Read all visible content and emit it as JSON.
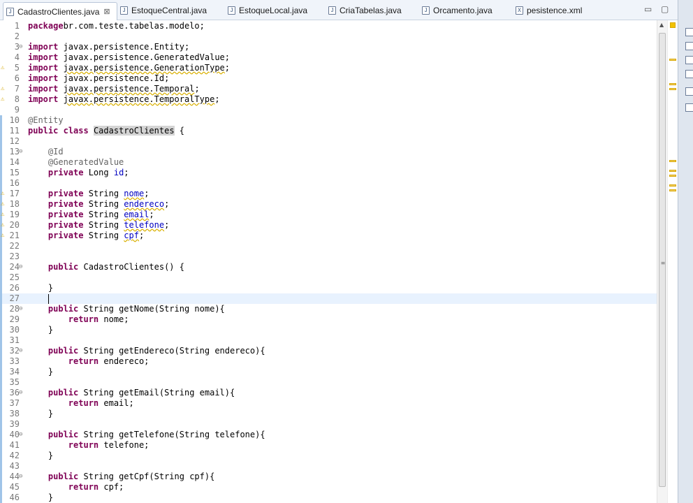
{
  "tabs": [
    {
      "label": "CadastroClientes.java",
      "icon": "java-file-icon",
      "glyph": "J",
      "active": true
    },
    {
      "label": "EstoqueCentral.java",
      "icon": "java-file-icon",
      "glyph": "J"
    },
    {
      "label": "EstoqueLocal.java",
      "icon": "java-file-icon",
      "glyph": "J"
    },
    {
      "label": "CriaTabelas.java",
      "icon": "java-file-icon",
      "glyph": "J"
    },
    {
      "label": "Orcamento.java",
      "icon": "java-file-icon",
      "glyph": "J"
    },
    {
      "label": "pesistence.xml",
      "icon": "xml-file-icon",
      "glyph": "X"
    }
  ],
  "close_glyph": "⊠",
  "window_controls": {
    "minimize": "▭",
    "maximize": "▢"
  },
  "colors": {
    "keyword": "#7f0055",
    "annotation": "#646464",
    "field": "#0000c0",
    "current_line": "#e8f2fe",
    "warning": "#d9b000"
  },
  "editor": {
    "current_line": 27,
    "lines": [
      {
        "n": 1,
        "parts": [
          [
            "kw",
            "package"
          ],
          [
            "",
            "br.com.teste.tabelas.modelo;"
          ]
        ]
      },
      {
        "n": 2,
        "parts": []
      },
      {
        "n": 3,
        "fold": true,
        "parts": [
          [
            "kw",
            "import"
          ],
          [
            "",
            " javax.persistence.Entity;"
          ]
        ]
      },
      {
        "n": 4,
        "parts": [
          [
            "kw",
            "import"
          ],
          [
            "",
            " javax.persistence.GeneratedValue;"
          ]
        ]
      },
      {
        "n": 5,
        "warn": true,
        "parts": [
          [
            "kw",
            "import"
          ],
          [
            "",
            " "
          ],
          [
            "sq",
            "javax.persistence.GenerationType"
          ],
          [
            "",
            ";"
          ]
        ]
      },
      {
        "n": 6,
        "parts": [
          [
            "kw",
            "import"
          ],
          [
            "",
            " javax.persistence.Id;"
          ]
        ]
      },
      {
        "n": 7,
        "warn": true,
        "parts": [
          [
            "kw",
            "import"
          ],
          [
            "",
            " "
          ],
          [
            "sq",
            "javax.persistence.Temporal"
          ],
          [
            "",
            ";"
          ]
        ]
      },
      {
        "n": 8,
        "warn": true,
        "parts": [
          [
            "kw",
            "import"
          ],
          [
            "",
            " "
          ],
          [
            "sq",
            "javax.persistence.TemporalType"
          ],
          [
            "",
            ";"
          ]
        ]
      },
      {
        "n": 9,
        "parts": []
      },
      {
        "n": 10,
        "bar": true,
        "parts": [
          [
            "ann",
            "@Entity"
          ]
        ]
      },
      {
        "n": 11,
        "bar": true,
        "parts": [
          [
            "kw",
            "public"
          ],
          [
            "",
            " "
          ],
          [
            "kw",
            "class"
          ],
          [
            "",
            " "
          ],
          [
            "hl",
            "CadastroClientes"
          ],
          [
            "",
            " {"
          ]
        ]
      },
      {
        "n": 12,
        "bar": true,
        "parts": []
      },
      {
        "n": 13,
        "bar": true,
        "fold": true,
        "parts": [
          [
            "",
            "    "
          ],
          [
            "ann",
            "@Id"
          ]
        ]
      },
      {
        "n": 14,
        "bar": true,
        "parts": [
          [
            "",
            "    "
          ],
          [
            "ann",
            "@GeneratedValue"
          ]
        ]
      },
      {
        "n": 15,
        "bar": true,
        "parts": [
          [
            "",
            "    "
          ],
          [
            "kw",
            "private"
          ],
          [
            "",
            " Long "
          ],
          [
            "fld",
            "id"
          ],
          [
            "",
            ";"
          ]
        ]
      },
      {
        "n": 16,
        "bar": true,
        "parts": []
      },
      {
        "n": 17,
        "bar": true,
        "warn": true,
        "parts": [
          [
            "",
            "    "
          ],
          [
            "kw",
            "private"
          ],
          [
            "",
            " String "
          ],
          [
            "fld sq",
            "nome"
          ],
          [
            "",
            ";"
          ]
        ]
      },
      {
        "n": 18,
        "bar": true,
        "warn": true,
        "parts": [
          [
            "",
            "    "
          ],
          [
            "kw",
            "private"
          ],
          [
            "",
            " String "
          ],
          [
            "fld sq",
            "endereco"
          ],
          [
            "",
            ";"
          ]
        ]
      },
      {
        "n": 19,
        "bar": true,
        "warn": true,
        "parts": [
          [
            "",
            "    "
          ],
          [
            "kw",
            "private"
          ],
          [
            "",
            " String "
          ],
          [
            "fld sq",
            "email"
          ],
          [
            "",
            ";"
          ]
        ]
      },
      {
        "n": 20,
        "bar": true,
        "warn": true,
        "parts": [
          [
            "",
            "    "
          ],
          [
            "kw",
            "private"
          ],
          [
            "",
            " String "
          ],
          [
            "fld sq",
            "telefone"
          ],
          [
            "",
            ";"
          ]
        ]
      },
      {
        "n": 21,
        "bar": true,
        "warn": true,
        "parts": [
          [
            "",
            "    "
          ],
          [
            "kw",
            "private"
          ],
          [
            "",
            " String "
          ],
          [
            "fld sq",
            "cpf"
          ],
          [
            "",
            ";"
          ]
        ]
      },
      {
        "n": 22,
        "bar": true,
        "parts": []
      },
      {
        "n": 23,
        "bar": true,
        "parts": []
      },
      {
        "n": 24,
        "bar": true,
        "fold": true,
        "parts": [
          [
            "",
            "    "
          ],
          [
            "kw",
            "public"
          ],
          [
            "",
            " CadastroClientes() {"
          ]
        ]
      },
      {
        "n": 25,
        "bar": true,
        "parts": []
      },
      {
        "n": 26,
        "bar": true,
        "parts": [
          [
            "",
            "    }"
          ]
        ]
      },
      {
        "n": 27,
        "bar": true,
        "caret": true,
        "parts": [
          [
            "",
            "    "
          ]
        ]
      },
      {
        "n": 28,
        "bar": true,
        "fold": true,
        "parts": [
          [
            "",
            "    "
          ],
          [
            "kw",
            "public"
          ],
          [
            "",
            " String getNome(String nome){"
          ]
        ]
      },
      {
        "n": 29,
        "bar": true,
        "parts": [
          [
            "",
            "        "
          ],
          [
            "kw",
            "return"
          ],
          [
            "",
            " nome;"
          ]
        ]
      },
      {
        "n": 30,
        "bar": true,
        "parts": [
          [
            "",
            "    }"
          ]
        ]
      },
      {
        "n": 31,
        "bar": true,
        "parts": []
      },
      {
        "n": 32,
        "bar": true,
        "fold": true,
        "parts": [
          [
            "",
            "    "
          ],
          [
            "kw",
            "public"
          ],
          [
            "",
            " String getEndereco(String endereco){"
          ]
        ]
      },
      {
        "n": 33,
        "bar": true,
        "parts": [
          [
            "",
            "        "
          ],
          [
            "kw",
            "return"
          ],
          [
            "",
            " endereco;"
          ]
        ]
      },
      {
        "n": 34,
        "bar": true,
        "parts": [
          [
            "",
            "    }"
          ]
        ]
      },
      {
        "n": 35,
        "bar": true,
        "parts": []
      },
      {
        "n": 36,
        "bar": true,
        "fold": true,
        "parts": [
          [
            "",
            "    "
          ],
          [
            "kw",
            "public"
          ],
          [
            "",
            " String getEmail(String email){"
          ]
        ]
      },
      {
        "n": 37,
        "bar": true,
        "parts": [
          [
            "",
            "        "
          ],
          [
            "kw",
            "return"
          ],
          [
            "",
            " email;"
          ]
        ]
      },
      {
        "n": 38,
        "bar": true,
        "parts": [
          [
            "",
            "    }"
          ]
        ]
      },
      {
        "n": 39,
        "bar": true,
        "parts": []
      },
      {
        "n": 40,
        "bar": true,
        "fold": true,
        "parts": [
          [
            "",
            "    "
          ],
          [
            "kw",
            "public"
          ],
          [
            "",
            " String getTelefone(String telefone){"
          ]
        ]
      },
      {
        "n": 41,
        "bar": true,
        "parts": [
          [
            "",
            "        "
          ],
          [
            "kw",
            "return"
          ],
          [
            "",
            " telefone;"
          ]
        ]
      },
      {
        "n": 42,
        "bar": true,
        "parts": [
          [
            "",
            "    }"
          ]
        ]
      },
      {
        "n": 43,
        "bar": true,
        "parts": []
      },
      {
        "n": 44,
        "bar": true,
        "fold": true,
        "parts": [
          [
            "",
            "    "
          ],
          [
            "kw",
            "public"
          ],
          [
            "",
            " String getCpf(String cpf){"
          ]
        ]
      },
      {
        "n": 45,
        "bar": true,
        "parts": [
          [
            "",
            "        "
          ],
          [
            "kw",
            "return"
          ],
          [
            "",
            " cpf;"
          ]
        ]
      },
      {
        "n": 46,
        "bar": true,
        "parts": [
          [
            "",
            "    }"
          ]
        ]
      }
    ]
  },
  "overview_markers": [
    {
      "at": 0.08
    },
    {
      "at": 0.13
    },
    {
      "at": 0.14
    },
    {
      "at": 0.29
    },
    {
      "at": 0.31
    },
    {
      "at": 0.32
    },
    {
      "at": 0.34
    },
    {
      "at": 0.35
    }
  ]
}
